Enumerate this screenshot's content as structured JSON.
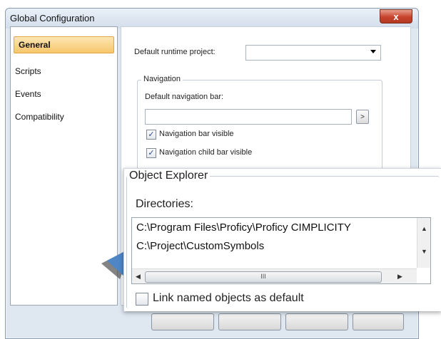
{
  "window": {
    "title": "Global Configuration",
    "close_glyph": "x"
  },
  "sidebar": {
    "items": [
      {
        "label": "General",
        "selected": true
      },
      {
        "label": "Scripts",
        "selected": false
      },
      {
        "label": "Events",
        "selected": false
      },
      {
        "label": "Compatibility",
        "selected": false
      }
    ]
  },
  "general": {
    "runtime_project_label": "Default runtime project:",
    "runtime_project_value": "",
    "navigation": {
      "group_label": "Navigation",
      "nav_bar_label": "Default navigation bar:",
      "nav_bar_value": "",
      "browse_glyph": ">",
      "nav_bar_visible_label": "Navigation bar visible",
      "nav_bar_visible_checked": true,
      "child_bar_visible_label": "Navigation child bar visible",
      "child_bar_visible_checked": true
    }
  },
  "object_explorer": {
    "group_label": "Object Explorer",
    "directories_label": "Directories:",
    "directories": [
      "C:\\Program Files\\Proficy\\Proficy CIMPLICITY",
      "C:\\Project\\CustomSymbols"
    ],
    "hscroll_grip": "III",
    "link_named_label": "Link named objects as default",
    "link_named_checked": false
  },
  "icons": {
    "scroll_up": "up-arrow-icon",
    "scroll_down": "down-arrow-icon",
    "scroll_left": "left-arrow-icon",
    "scroll_right": "right-arrow-icon",
    "pointer": "callout-pointer-icon",
    "checkmark": "check-icon"
  },
  "colors": {
    "selected_item_bg": "#f7c66c",
    "close_button": "#c7432b",
    "pointer_blue": "#4f86c6"
  }
}
